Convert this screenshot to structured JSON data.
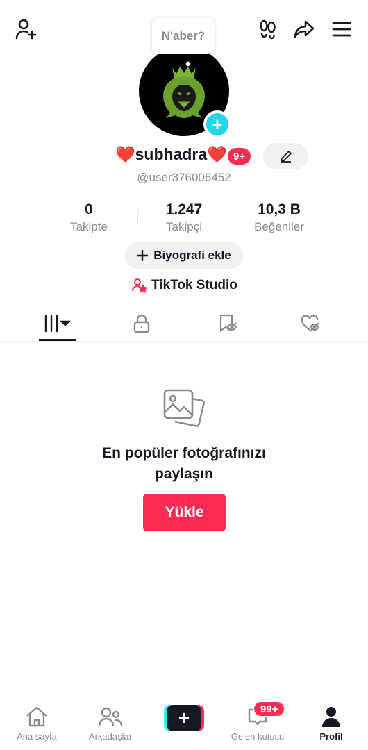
{
  "top_bar": {
    "icons": [
      "add-user-icon",
      "footprint-icon",
      "share-icon",
      "menu-icon"
    ]
  },
  "profile": {
    "note": "N'aber?",
    "display_name": "❤️subhadra❤️",
    "notification_badge": "9+",
    "handle": "@user376006452",
    "stats": [
      {
        "value": "0",
        "label": "Takipte"
      },
      {
        "value": "1.247",
        "label": "Takipçi"
      },
      {
        "value": "10,3 B",
        "label": "Beğeniler"
      }
    ],
    "bio_button": "Biyografi ekle",
    "studio_link": "TikTok Studio"
  },
  "tabs": {
    "items": [
      "videos-grid-icon",
      "lock-icon",
      "tagged-hidden-icon",
      "liked-hidden-icon"
    ],
    "active_index": 0
  },
  "empty_state": {
    "title_line1": "En popüler fotoğrafınızı",
    "title_line2": "paylaşın",
    "button": "Yükle"
  },
  "bottom_nav": {
    "items": [
      {
        "label": "Ana sayfa",
        "icon": "home-icon"
      },
      {
        "label": "Arkadaşlar",
        "icon": "friends-icon"
      },
      {
        "label": "",
        "icon": "create-icon"
      },
      {
        "label": "Gelen kutusu",
        "icon": "inbox-icon"
      },
      {
        "label": "Profil",
        "icon": "profile-icon"
      }
    ],
    "inbox_badge": "99+",
    "active": "Profil"
  },
  "colors": {
    "accent": "#fe2c55",
    "cyan": "#25f4ee",
    "text": "#161823",
    "muted": "#8a8b91"
  }
}
